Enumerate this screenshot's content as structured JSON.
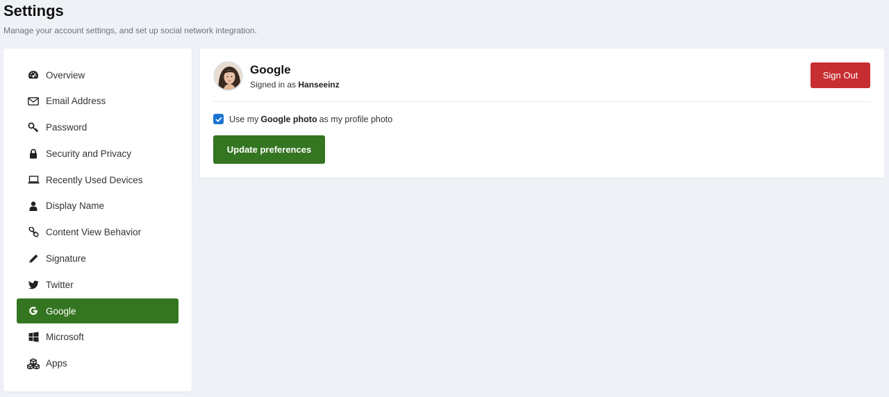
{
  "header": {
    "title": "Settings",
    "subtitle": "Manage your account settings, and set up social network integration."
  },
  "sidebar": {
    "items": [
      {
        "label": "Overview",
        "icon": "dashboard-icon"
      },
      {
        "label": "Email Address",
        "icon": "envelope-icon"
      },
      {
        "label": "Password",
        "icon": "key-icon"
      },
      {
        "label": "Security and Privacy",
        "icon": "lock-icon"
      },
      {
        "label": "Recently Used Devices",
        "icon": "laptop-icon"
      },
      {
        "label": "Display Name",
        "icon": "user-icon"
      },
      {
        "label": "Content View Behavior",
        "icon": "link-icon"
      },
      {
        "label": "Signature",
        "icon": "pencil-icon"
      },
      {
        "label": "Twitter",
        "icon": "twitter-icon"
      },
      {
        "label": "Google",
        "icon": "google-icon",
        "active": true
      },
      {
        "label": "Microsoft",
        "icon": "windows-icon"
      },
      {
        "label": "Apps",
        "icon": "cubes-icon"
      }
    ]
  },
  "account": {
    "provider": "Google",
    "signed_in_prefix": "Signed in as",
    "username": "Hanseeinz",
    "sign_out_label": "Sign Out"
  },
  "preferences": {
    "checkbox_checked": true,
    "photo_text_before": "Use my",
    "photo_text_bold": "Google photo",
    "photo_text_after": "as my profile photo",
    "update_label": "Update preferences"
  },
  "colors": {
    "accent_green": "#347521",
    "danger_red": "#c62e32",
    "checkbox_blue": "#1b74d1",
    "background": "#eef1f6"
  }
}
